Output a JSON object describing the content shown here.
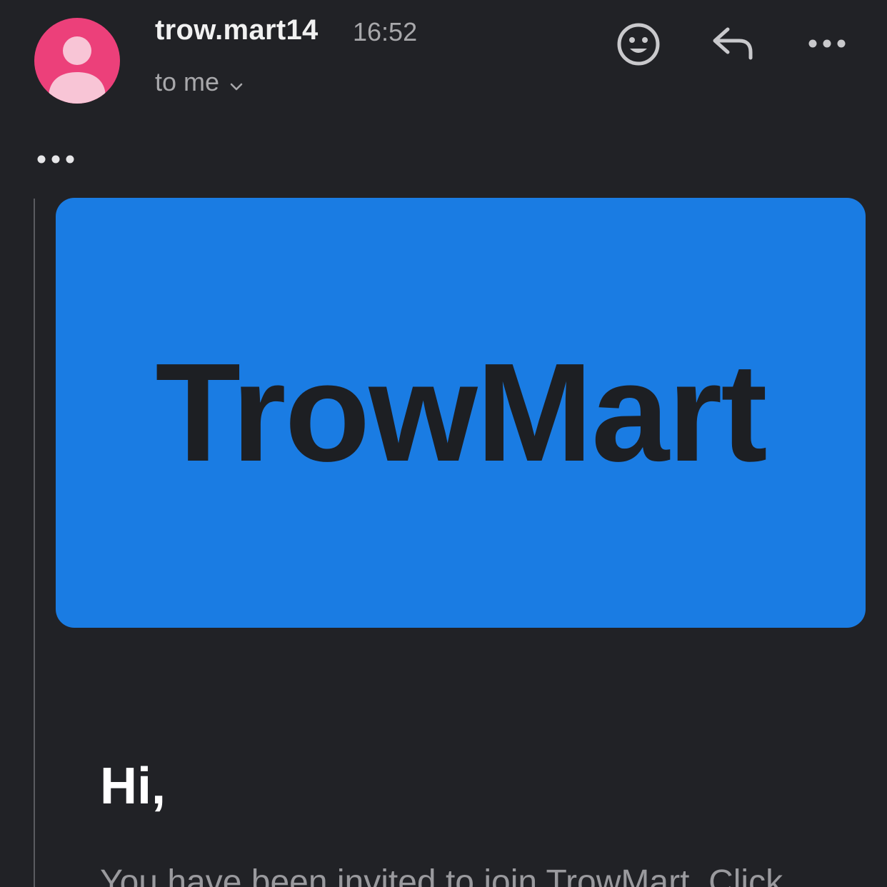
{
  "header": {
    "sender": "trow.mart14",
    "time": "16:52",
    "recipients_label": "to me",
    "avatar_color": "#ec407a"
  },
  "icons": {
    "emoji": "smiley-icon",
    "reply": "reply-icon",
    "more": "more-horizontal-icon",
    "trimmed": "ellipsis-icon",
    "chevron": "chevron-down-icon"
  },
  "message": {
    "banner_text": "TrowMart",
    "banner_color": "#1a7ce3",
    "greeting": "Hi,",
    "body_first_line": "You have been invited to join TrowMart. Click"
  }
}
